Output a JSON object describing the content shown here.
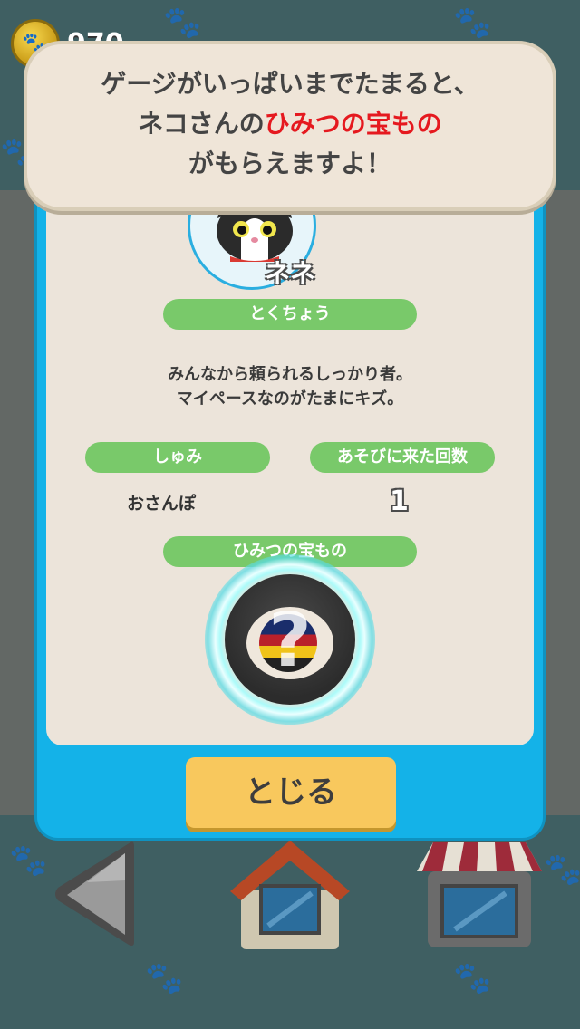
{
  "coins": {
    "count": "970"
  },
  "speech_bubble": {
    "line1": "ゲージがいっぱいまでたまると、",
    "line2_prefix": "ネコさんの",
    "line2_highlight": "ひみつの宝もの",
    "line3": "がもらえますよ！"
  },
  "profile": {
    "name": "ネネ",
    "trait_header": "とくちょう",
    "description": "みんなから頼られるしっかり者。\nマイペースなのがたまにキズ。",
    "hobby_header": "しゅみ",
    "hobby_value": "おさんぽ",
    "visits_header": "あそびに来た回数",
    "visits_value": "1",
    "treasure_header": "ひみつの宝もの",
    "treasure_symbol": "?"
  },
  "buttons": {
    "close_label": "とじる"
  },
  "colors": {
    "panel_blue": "#14b2e8",
    "pill_green": "#79c96a",
    "close_yellow": "#f8c85d",
    "highlight_red": "#e5191f"
  },
  "icons": [
    "coin-paw-icon",
    "back-arrow-icon",
    "home-icon",
    "shop-icon",
    "paw-icon"
  ]
}
